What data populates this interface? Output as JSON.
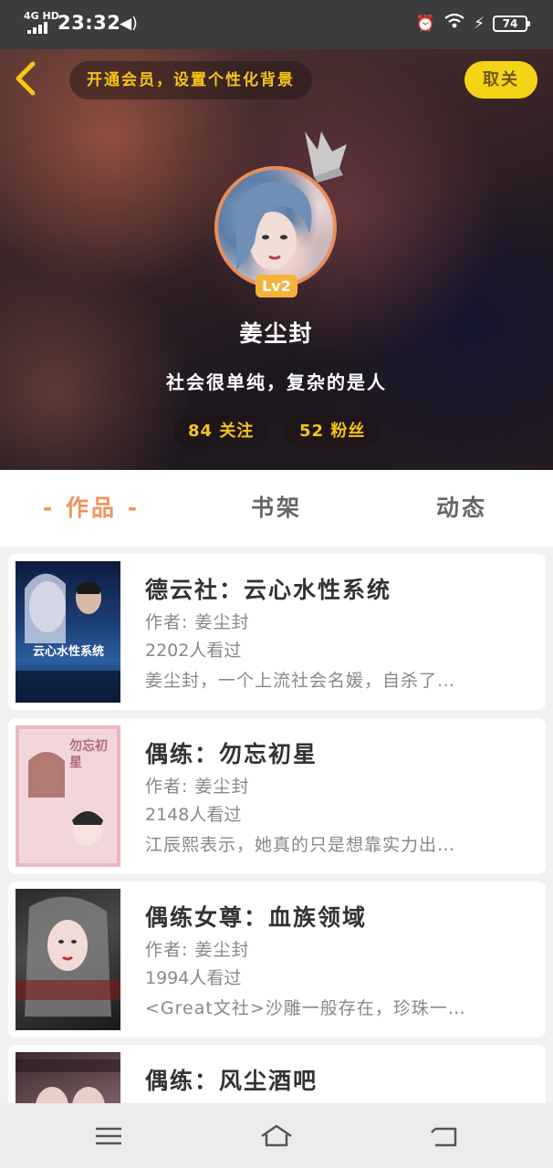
{
  "status_bar": {
    "network": "4G HD",
    "time": "23:32",
    "battery": "74"
  },
  "header": {
    "back_icon": "chevron-left-icon",
    "vip_prompt": "开通会员，设置个性化背景",
    "follow_label": "取关"
  },
  "profile": {
    "level": "Lv2",
    "name": "姜尘封",
    "bio": "社会很单纯，复杂的是人",
    "following": "84 关注",
    "followers": "52 粉丝"
  },
  "tabs": [
    {
      "label": "作品",
      "active": true
    },
    {
      "label": "书架",
      "active": false
    },
    {
      "label": "动态",
      "active": false
    }
  ],
  "active_tab_marker": "-",
  "works": [
    {
      "title": "德云社：云心水性系统",
      "author": "作者: 姜尘封",
      "views": "2202人看过",
      "desc": "姜尘封，一个上流社会名媛，自杀了…",
      "cover_text": "云心水性系统"
    },
    {
      "title": "偶练：勿忘初星",
      "author": "作者: 姜尘封",
      "views": "2148人看过",
      "desc": "江辰熙表示，她真的只是想靠实力出…",
      "cover_text": "勿忘初星"
    },
    {
      "title": "偶练女尊：血族领域",
      "author": "作者: 姜尘封",
      "views": "1994人看过",
      "desc": "<Great文社>沙雕一般存在，珍珠一…",
      "cover_text": ""
    },
    {
      "title": "偶练：风尘酒吧",
      "author": "",
      "views": "",
      "desc": "",
      "cover_text": ""
    }
  ],
  "colors": {
    "accent": "#f0935a",
    "gold": "#f5c518",
    "follow_bg": "#f5d418"
  }
}
